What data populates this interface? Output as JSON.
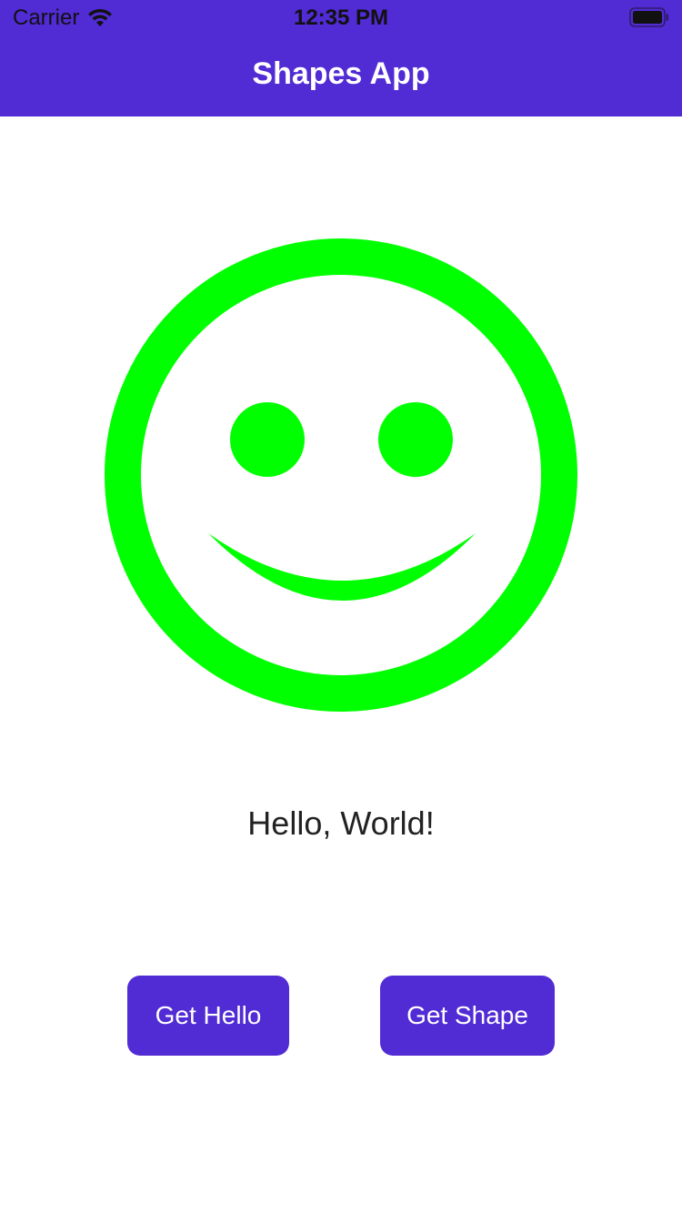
{
  "status_bar": {
    "carrier": "Carrier",
    "time": "12:35 PM",
    "icons": [
      "wifi-icon",
      "battery-icon"
    ]
  },
  "nav": {
    "title": "Shapes App"
  },
  "shape": {
    "type": "smiley-face",
    "color": "#00ff00"
  },
  "greeting": {
    "text": "Hello, World!"
  },
  "buttons": {
    "get_hello": "Get Hello",
    "get_shape": "Get Shape"
  },
  "colors": {
    "accent": "#512bd4",
    "shape": "#00ff00",
    "background": "#ffffff"
  }
}
